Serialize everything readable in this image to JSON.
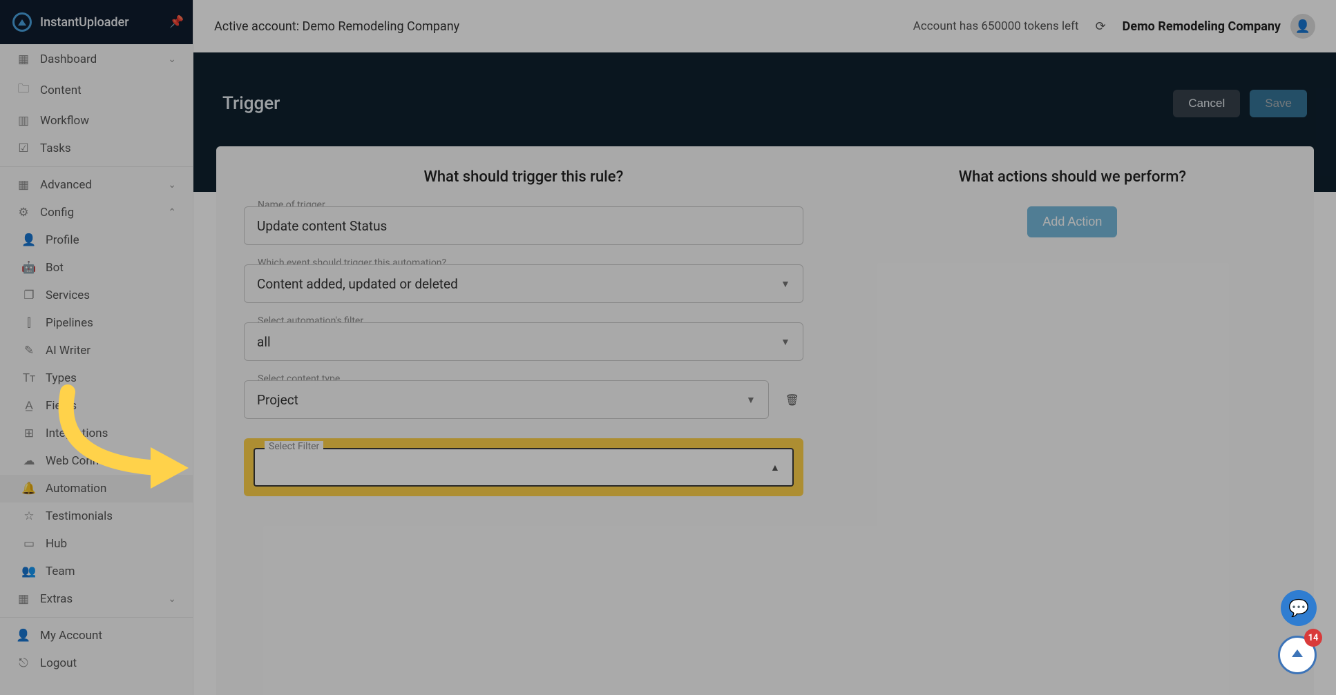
{
  "brand": {
    "name": "InstantUploader"
  },
  "sidebar": {
    "top": [
      {
        "label": "Dashboard",
        "icon": "grid",
        "expandable": true
      },
      {
        "label": "Content",
        "icon": "folder"
      },
      {
        "label": "Workflow",
        "icon": "grid4"
      },
      {
        "label": "Tasks",
        "icon": "check-square"
      }
    ],
    "mid_group": [
      {
        "label": "Advanced",
        "icon": "grid",
        "expandable": true
      },
      {
        "label": "Config",
        "icon": "gear",
        "expanded": true
      }
    ],
    "config_children": [
      {
        "label": "Profile",
        "icon": "user"
      },
      {
        "label": "Bot",
        "icon": "bot"
      },
      {
        "label": "Services",
        "icon": "library"
      },
      {
        "label": "Pipelines",
        "icon": "pipe"
      },
      {
        "label": "AI Writer",
        "icon": "pencil"
      },
      {
        "label": "Types",
        "icon": "type"
      },
      {
        "label": "Fields",
        "icon": "field"
      },
      {
        "label": "Integrations",
        "icon": "plus-box"
      },
      {
        "label": "Web Connect",
        "icon": "cloud"
      },
      {
        "label": "Automation",
        "icon": "bell"
      },
      {
        "label": "Testimonials",
        "icon": "star"
      },
      {
        "label": "Hub",
        "icon": "hub"
      },
      {
        "label": "Team",
        "icon": "team"
      }
    ],
    "extras": {
      "label": "Extras",
      "icon": "grid",
      "expandable": true
    },
    "footer": [
      {
        "label": "My Account",
        "icon": "user"
      },
      {
        "label": "Logout",
        "icon": "exit"
      }
    ]
  },
  "topbar": {
    "active_account_prefix": "Active account: ",
    "active_account": "Demo Remodeling Company",
    "tokens_text": "Account has 650000 tokens left",
    "company": "Demo Remodeling Company"
  },
  "page": {
    "title": "Trigger",
    "cancel": "Cancel",
    "save": "Save"
  },
  "trigger_section": {
    "heading": "What should trigger this rule?",
    "name_label": "Name of trigger",
    "name_value": "Update content Status",
    "event_label": "Which event should trigger this automation?",
    "event_value": "Content added, updated or deleted",
    "filter_label": "Select automation's filter",
    "filter_value": "all",
    "content_type_label": "Select content type",
    "content_type_value": "Project",
    "select_filter_label": "Select Filter",
    "select_filter_value": ""
  },
  "actions_section": {
    "heading": "What actions should we perform?",
    "add_action": "Add Action"
  },
  "badge_count": "14"
}
